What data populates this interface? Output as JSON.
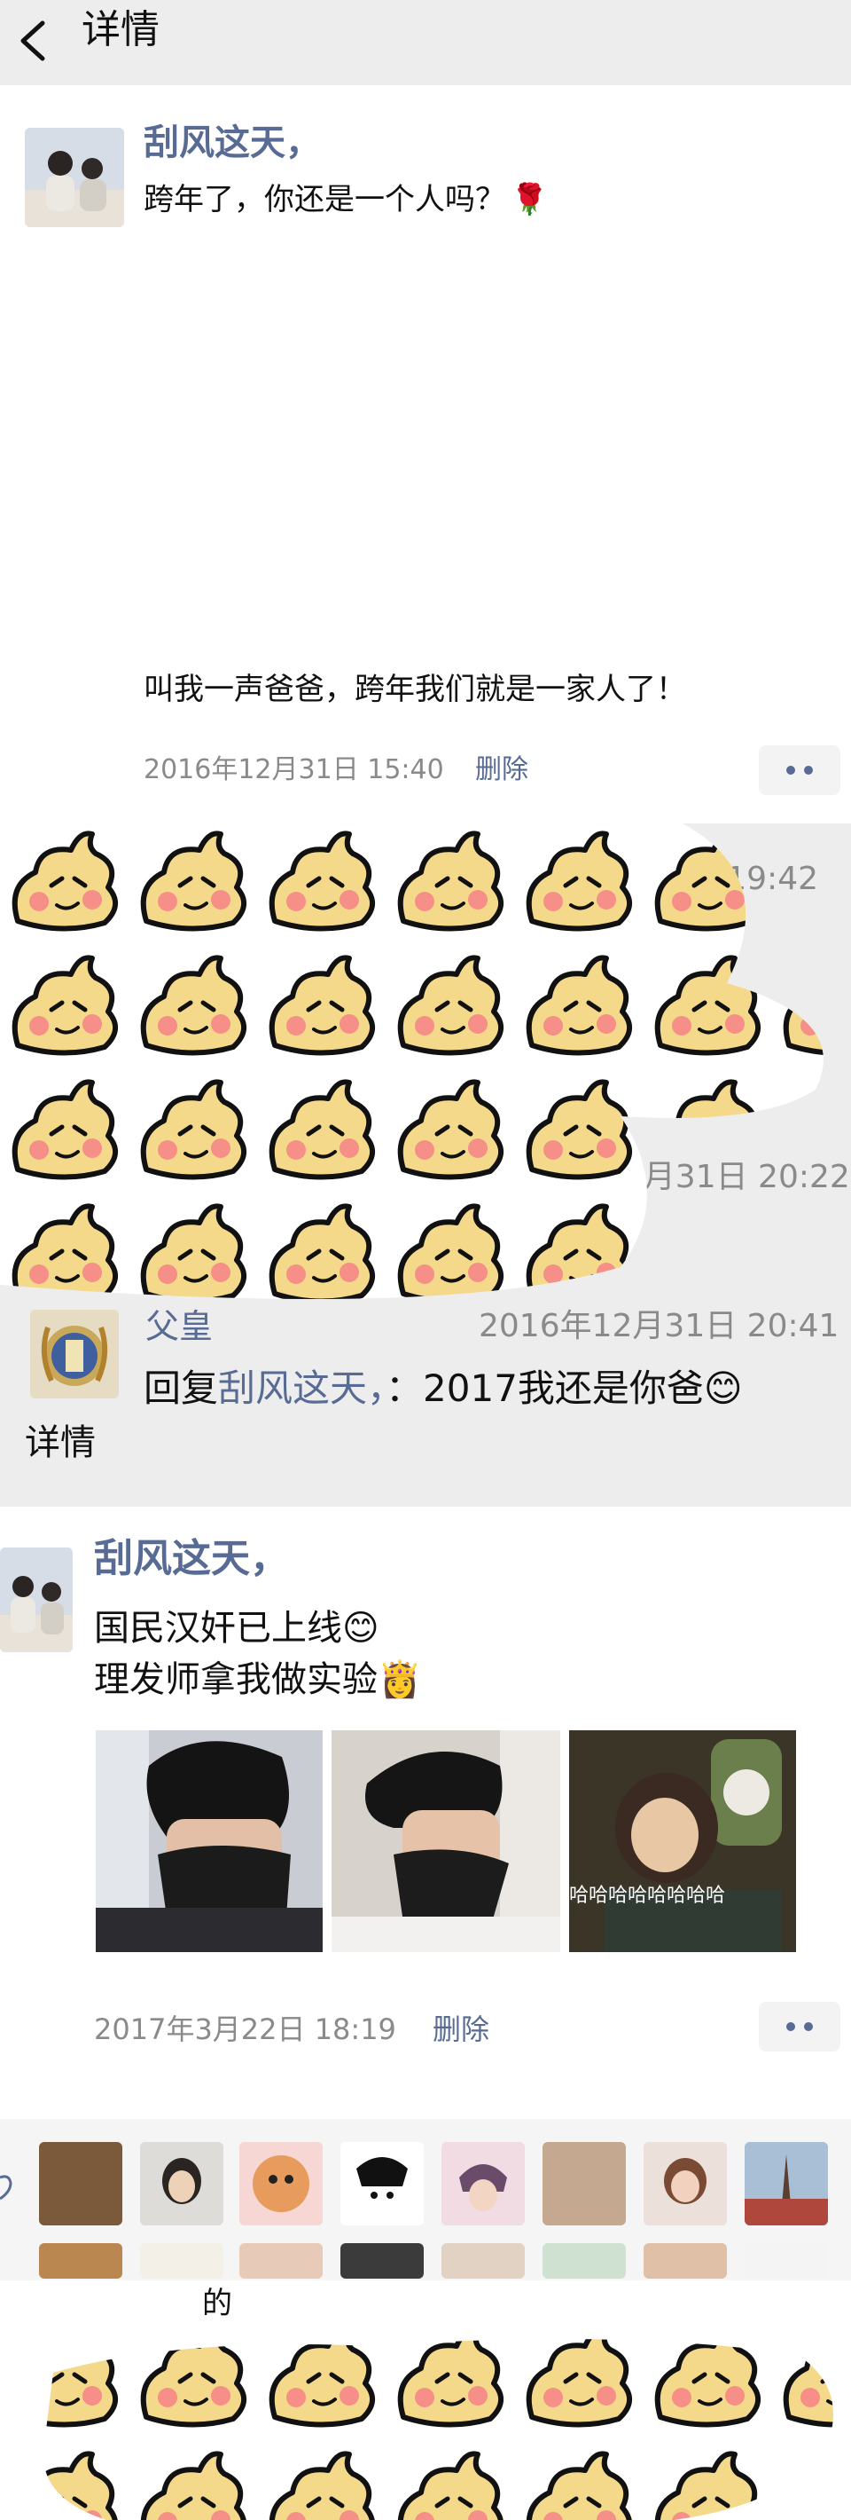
{
  "nav": {
    "title": "详情"
  },
  "post1": {
    "author": "刮风这天，",
    "text": "跨年了，你还是一个人吗？",
    "emoji": "🌹",
    "caption": "叫我一声爸爸，跨年我们就是一家人了！",
    "time": "2016年12月31日 15:40",
    "delete": "删除"
  },
  "comments": {
    "partial_times": [
      "31日 19:42",
      "12月31日 20:22"
    ],
    "comment": {
      "author": "父皇",
      "time": "2016年12月31日 20:41",
      "reply_prefix": "回复",
      "reply_to": "刮风这天，",
      "text": "：2017我还是你爸",
      "emoji": "😊"
    },
    "footer_text": "详情"
  },
  "post2": {
    "author": "刮风这天，",
    "line1": "国民汉奸已上线",
    "line1_emoji": "😊",
    "line2": "理发师拿我做实验",
    "line2_emoji": "👸",
    "photo3_caption": "哈哈哈哈哈哈哈哈",
    "time": "2017年3月22日 18:19",
    "delete": "删除"
  },
  "likes": {
    "label": "的"
  },
  "colors": {
    "link": "#576b95",
    "background": "#ededed",
    "card": "#ffffff",
    "sticker_body": "#f4d98a",
    "sticker_cheek": "#f58f88"
  }
}
